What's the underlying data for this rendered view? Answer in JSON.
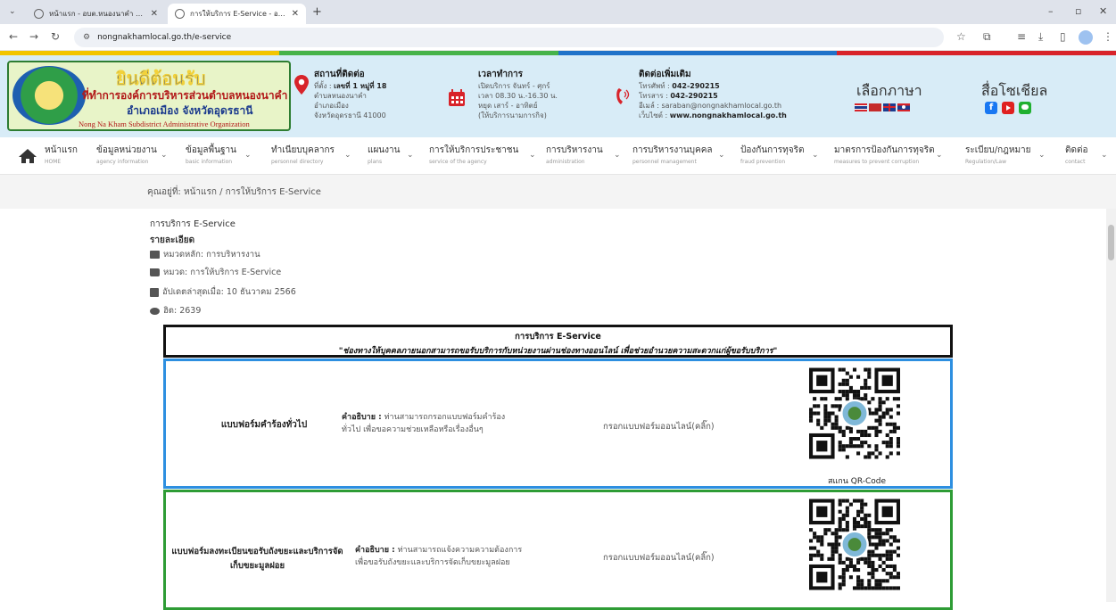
{
  "browser": {
    "tabs": [
      {
        "title": "หน้าแรก - อบต.หนองนาคำ อ.เมือง",
        "active": false
      },
      {
        "title": "การให้บริการ E-Service - อบต.หนอ",
        "active": true
      }
    ],
    "new_tab": "+",
    "url": "nongnakhamlocal.go.th/e-service",
    "window_controls": [
      "–",
      "▫",
      "✕"
    ]
  },
  "header": {
    "logo": {
      "welcome": "ยินดีต้อนรับ",
      "org": "ที่ทำการองค์การบริหารส่วนตำบลหนองนาคำ",
      "district": "อำเภอเมือง จังหวัดอุดรธานี",
      "english": "Nong Na Kham Subdistrict Administrative Organization"
    },
    "contact": {
      "title": "สถานที่ติดต่อ",
      "l1_label": "ที่ตั้ง :",
      "l1_value": "เลขที่ 1 หมู่ที่ 18",
      "l2": "ตำบลหนองนาคำ",
      "l3": "อำเภอเมือง",
      "l4": "จังหวัดอุดรธานี 41000"
    },
    "hours": {
      "title": "เวลาทำการ",
      "l1": "เปิดบริการ จันทร์ - ศุกร์",
      "l2": "เวลา 08.30 น.-16.30 น.",
      "l3": "หยุด เสาร์ - อาทิตย์",
      "l4": "(ให้บริการนามการกิจ)"
    },
    "more": {
      "title": "ติดต่อเพิ่มเติม",
      "phone_label": "โทรศัพท์ :",
      "phone": "042-290215",
      "fax_label": "โทรสาร :",
      "fax": "042-290215",
      "email": "อีเมล์ : saraban@nongnakhamlocal.go.th",
      "site_label": "เว็บไซต์ :",
      "site": "www.nongnakhamlocal.go.th"
    },
    "lang_title": "เลือกภาษา",
    "social_title": "สื่อโซเชียล",
    "colors": [
      "#f2c500",
      "#47b34a",
      "#1f72c9",
      "#d8232a"
    ]
  },
  "nav": {
    "items": [
      {
        "main": "หน้าแรก",
        "sub": "HOME",
        "caret": false
      },
      {
        "main": "ข้อมูลหน่วยงาน",
        "sub": "agency information",
        "caret": true
      },
      {
        "main": "ข้อมูลพื้นฐาน",
        "sub": "basic information",
        "caret": true
      },
      {
        "main": "ทำเนียบบุคลากร",
        "sub": "personnel directory",
        "caret": true
      },
      {
        "main": "แผนงาน",
        "sub": "plans",
        "caret": true
      },
      {
        "main": "การให้บริการประชาชน",
        "sub": "service of the agency",
        "caret": true
      },
      {
        "main": "การบริหารงาน",
        "sub": "administration",
        "caret": true
      },
      {
        "main": "การบริหารงานบุคคล",
        "sub": "personnel management",
        "caret": true
      },
      {
        "main": "ป้องกันการทุจริต",
        "sub": "fraud prevention",
        "caret": true
      },
      {
        "main": "มาตรการป้องกันการทุจริต",
        "sub": "measures to prevent corruption",
        "caret": true
      },
      {
        "main": "ระเบียบ/กฎหมาย",
        "sub": "Regulation/Law",
        "caret": true
      },
      {
        "main": "ติดต่อ",
        "sub": "contact",
        "caret": true
      }
    ]
  },
  "breadcrumb": "คุณอยู่ที่:  หน้าแรก  /  การให้บริการ E-Service",
  "article": {
    "title": "การบริการ E-Service",
    "detail_label": "รายละเอียด",
    "main_category": "หมวดหลัก: การบริหารงาน",
    "category": "หมวด: การให้บริการ E-Service",
    "updated": "อัปเดตล่าสุดเมื่อ: 10 ธันวาคม 2566",
    "hits": "ฮิต: 2639"
  },
  "banner": {
    "title": "การบริการ E-Service",
    "subtitle": "\"ช่องทางให้บุคคลภายนอกสามารถขอรับบริการกับหน่วยงานผ่านช่องทางออนไลน์ เพื่อช่วยอำนวยความสะดวกแก่ผู้ขอรับบริการ\""
  },
  "services": [
    {
      "name": "แบบฟอร์มคำร้องทั่วไป",
      "desc_label": "คำอธิบาย :",
      "desc": "ท่านสามารถกรอกแบบฟอร์มคำร้อง",
      "desc2": "ทั่วไป เพื่อขอความช่วยเหลือหรือเรื่องอื่นๆ",
      "link": "กรอกแบบฟอร์มออนไลน์(คลิ๊ก)",
      "qr_caption": "สแกน QR-Code",
      "border": "#2d8fe0"
    },
    {
      "name": "แบบฟอร์มลงทะเบียนขอรับถังขยะและบริการจัด",
      "name2": "เก็บขยะมูลฝอย",
      "desc_label": "คำอธิบาย :",
      "desc": "ท่านสามารถแจ้งความความต้องการ",
      "desc2": "เพื่อขอรับถังขยะและบริการจัดเก็บขยะมูลฝอย",
      "link": "กรอกแบบฟอร์มออนไลน์(คลิ๊ก)",
      "qr_caption": "",
      "border": "#2e9c35"
    }
  ]
}
